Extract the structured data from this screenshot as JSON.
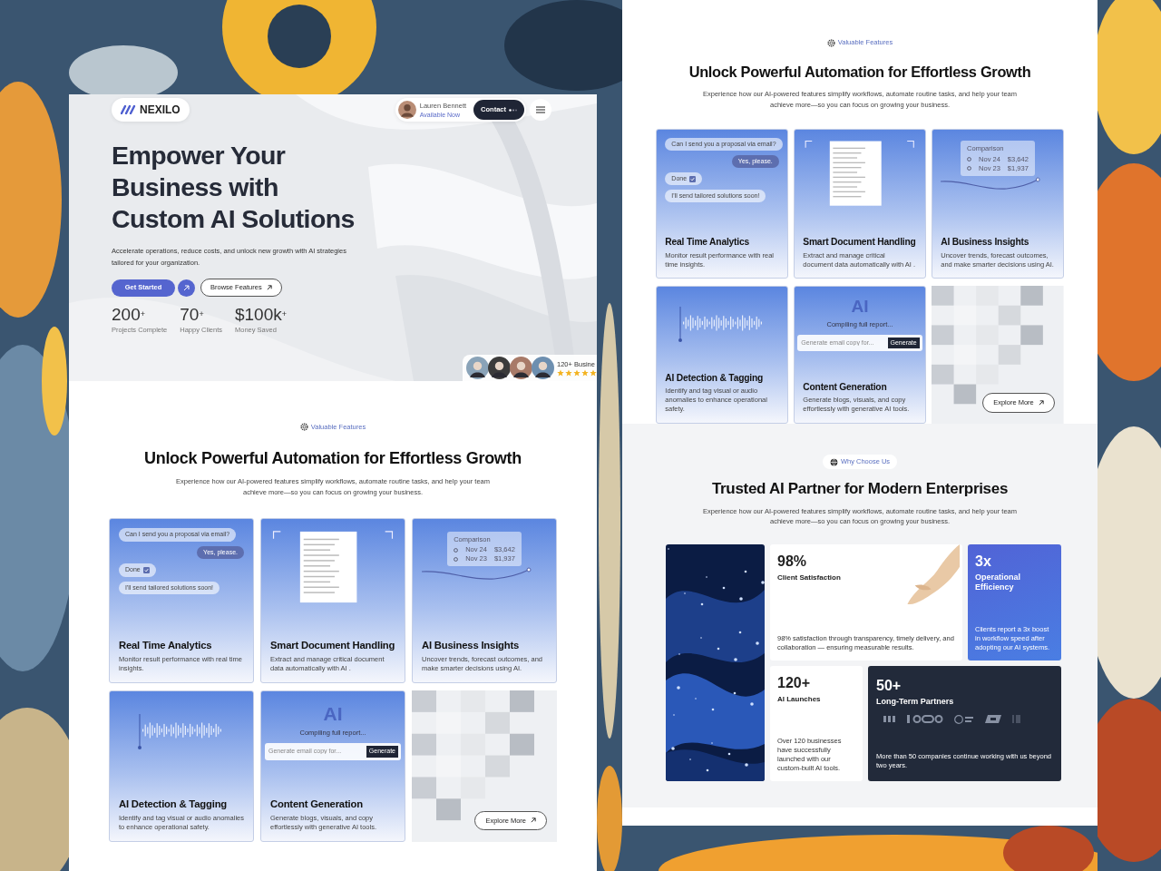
{
  "hero": {
    "brand": "NEXILO",
    "user": {
      "name": "Lauren Bennett",
      "status": "Available Now"
    },
    "contact_button": "Contact",
    "title": "Empower Your Business with Custom AI Solutions",
    "description": "Accelerate operations, reduce costs, and unlock new growth with AI strategies tailored for your organization.",
    "primary_button": "Get Started",
    "secondary_button": "Browse Features",
    "stats": [
      {
        "value": "200$^{+}$",
        "label": "Projects Complete"
      },
      {
        "value": "70$^{+}$",
        "label": "Happy Clients"
      },
      {
        "value": "$100k$^{+}$",
        "label": "Money Saved"
      }
    ],
    "social_proof": {
      "text": "120+ Busine",
      "stars": 5
    }
  },
  "features_left": {
    "tag": "Valuable Features",
    "title": "Unlock Powerful Automation for Effortless Growth",
    "description": "Experience how our AI-powered features simplify workflows, automate routine tasks, and help your team achieve more—so you can focus on growing your business.",
    "cards": [
      {
        "kind": "chat",
        "title": "Real Time Analytics",
        "description": "Monitor result performance with real time insights.",
        "messages": [
          {
            "kind": "incoming",
            "text": "Can I send you a proposal via email?"
          },
          {
            "kind": "outgoing",
            "text": "Yes, please."
          },
          {
            "kind": "confirmation",
            "text": "Done"
          },
          {
            "kind": "incoming",
            "text": "I'll send tailored solutions soon!"
          }
        ]
      },
      {
        "kind": "document",
        "title": "Smart Document Handling",
        "description": "Extract and manage critical document data automatically with AI ."
      },
      {
        "kind": "comparison",
        "title": "AI Business Insights",
        "description": "Uncover trends, forecast outcomes, and make smarter decisions using AI.",
        "heading": "Comparison",
        "rows": [
          {
            "date": "Nov 24",
            "amount": "$3,642"
          },
          {
            "date": "Nov 23",
            "amount": "$1,937"
          }
        ]
      },
      {
        "kind": "waveform",
        "title": "AI Detection & Tagging",
        "description": "Identify and tag visual or audio anomalies to enhance operational safety."
      },
      {
        "kind": "generator",
        "title": "Content Generation",
        "description": "Generate blogs, visuals, and copy effortlessly with generative AI tools.",
        "mark": "AI",
        "status": "Compiling full report...",
        "placeholder": "Generate email copy for...",
        "button": "Generate"
      },
      {
        "kind": "mosaic",
        "button": "Explore More"
      }
    ]
  },
  "features_right": {
    "tag": "Valuable Features",
    "title": "Unlock Powerful Automation for Effortless Growth",
    "description": "Experience how our AI-powered features simplify workflows, automate routine tasks, and help your team achieve more—so you can focus on growing your business.",
    "cards": [
      {
        "kind": "chat",
        "title": "Real Time Analytics",
        "description": "Monitor result performance with real time insights.",
        "messages": [
          {
            "kind": "incoming",
            "text": "Can I send you a proposal via email?"
          },
          {
            "kind": "outgoing",
            "text": "Yes, please."
          },
          {
            "kind": "confirmation",
            "text": "Done"
          },
          {
            "kind": "incoming",
            "text": "I'll send tailored solutions soon!"
          }
        ]
      },
      {
        "kind": "document",
        "title": "Smart Document Handling",
        "description": "Extract and manage critical document data automatically with AI ."
      },
      {
        "kind": "comparison",
        "title": "AI Business Insights",
        "description": "Uncover trends, forecast outcomes, and make smarter decisions using AI.",
        "heading": "Comparison",
        "rows": [
          {
            "date": "Nov 24",
            "amount": "$3,642"
          },
          {
            "date": "Nov 23",
            "amount": "$1,937"
          }
        ]
      },
      {
        "kind": "waveform",
        "title": "AI Detection & Tagging",
        "description": "Identify and tag visual or audio anomalies to enhance operational safety."
      },
      {
        "kind": "generator",
        "title": "Content Generation",
        "description": "Generate blogs, visuals, and copy effortlessly with generative AI tools.",
        "mark": "AI",
        "status": "Compiling full report...",
        "placeholder": "Generate email copy for...",
        "button": "Generate"
      },
      {
        "kind": "mosaic",
        "button": "Explore More"
      }
    ]
  },
  "why": {
    "tag": "Why Choose Us",
    "title": "Trusted AI Partner for Modern Enterprises",
    "description": "Experience how our AI-powered features simplify workflows, automate routine tasks, and help your team achieve more—so you can focus on growing your business.",
    "cards": [
      {
        "kind": "picture"
      },
      {
        "kind": "stat",
        "value": "98%",
        "label": "Client Satisfaction",
        "description": "98% satisfaction through transparency, timely delivery, and collaboration — ensuring measurable results."
      },
      {
        "kind": "highlight",
        "value": "3x",
        "label": "Operational Efficiency",
        "description": "Clients report a 3x boost in workflow speed after adopting our AI systems."
      },
      {
        "kind": "stat",
        "value": "120+",
        "label": "AI Launches",
        "description": "Over 120 businesses have successfully launched with our custom-built AI tools."
      },
      {
        "kind": "partners",
        "value": "50+",
        "label": "Long-Term Partners",
        "description": "More than 50 companies continue working with us beyond two years."
      }
    ]
  }
}
